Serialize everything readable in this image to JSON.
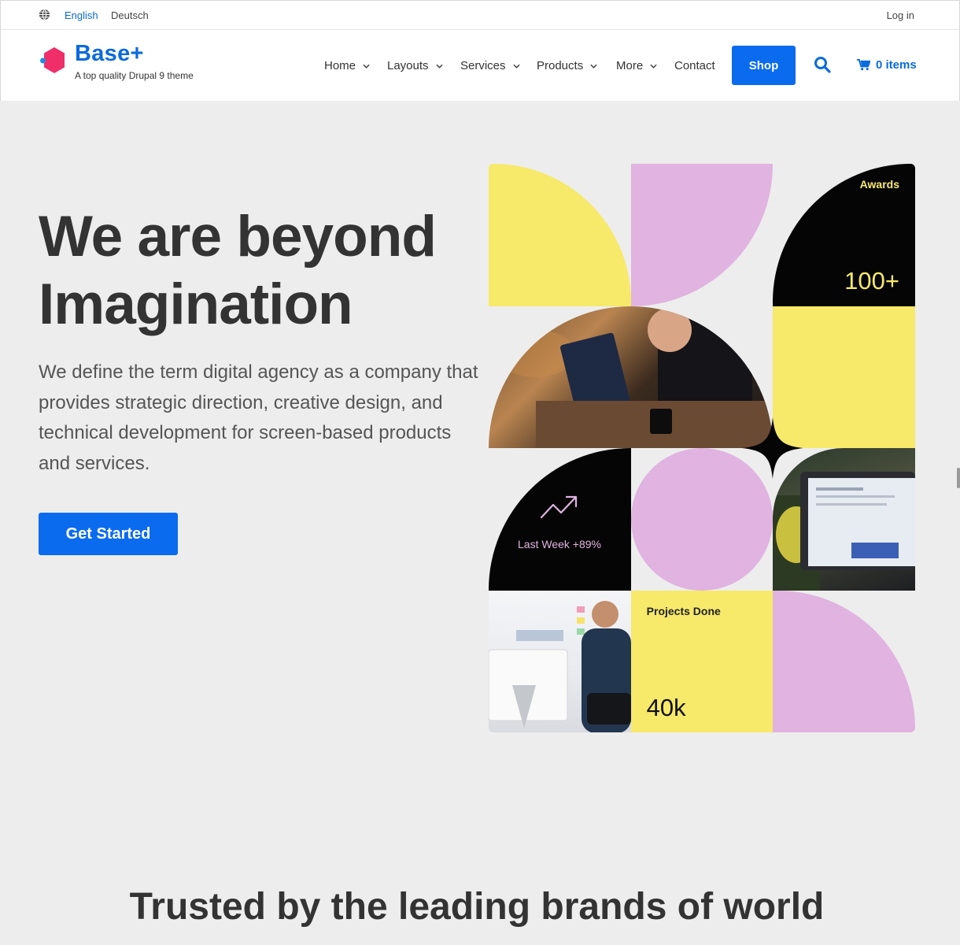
{
  "topbar": {
    "languages": [
      "English",
      "Deutsch"
    ],
    "login": "Log in"
  },
  "header": {
    "site_name": "Base+",
    "slogan": "A top quality Drupal 9 theme",
    "nav": [
      "Home",
      "Layouts",
      "Services",
      "Products",
      "More",
      "Contact"
    ],
    "shop": "Shop",
    "cart": "0 items"
  },
  "hero": {
    "title_line1": "We are beyond",
    "title_line2": "Imagination",
    "text": "We define the term digital agency as a company that provides strategic direction, creative design, and technical development for screen-based products and services.",
    "cta": "Get Started"
  },
  "mosaic": {
    "awards_label": "Awards",
    "awards_value": "100+",
    "week_label": "Last Week +89%",
    "projects_label": "Projects Done",
    "projects_value": "40k"
  },
  "colors": {
    "brand": "#0a6bef",
    "yellow": "#f7e96a",
    "pink": "#e0b3e0",
    "black": "#050505"
  },
  "trusted": {
    "title": "Trusted by the leading brands of world"
  }
}
